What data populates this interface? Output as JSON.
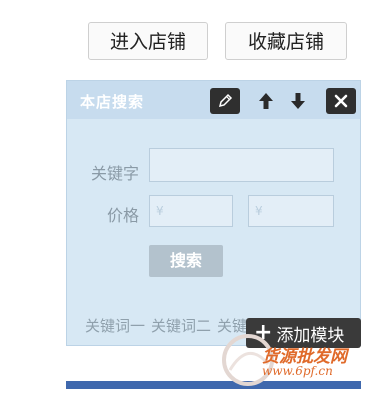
{
  "top_buttons": {
    "enter_store": "进入店铺",
    "favorite_store": "收藏店铺"
  },
  "panel": {
    "title": "本店搜索",
    "tools": {
      "edit": "edit-icon",
      "up": "arrow-up-icon",
      "down": "arrow-down-icon",
      "close": "close-icon"
    },
    "keyword_label": "关键字",
    "keyword_value": "",
    "price_label": "价格",
    "price_min_placeholder": "¥",
    "price_max_placeholder": "¥",
    "search_button": "搜索",
    "keywords": [
      "关键词一",
      "关键词二",
      "关键词三"
    ]
  },
  "add_module": {
    "icon": "+",
    "label": "添加模块"
  },
  "watermark": {
    "text": "货源批发网",
    "domain": "www.6pf.cn"
  },
  "colors": {
    "panel_bg": "#d7e8f4",
    "header_bg": "#c7dcee",
    "toolbar_dark": "#2f2f2f",
    "accent_bar": "#3f68ad",
    "watermark": "#e06a2a"
  }
}
